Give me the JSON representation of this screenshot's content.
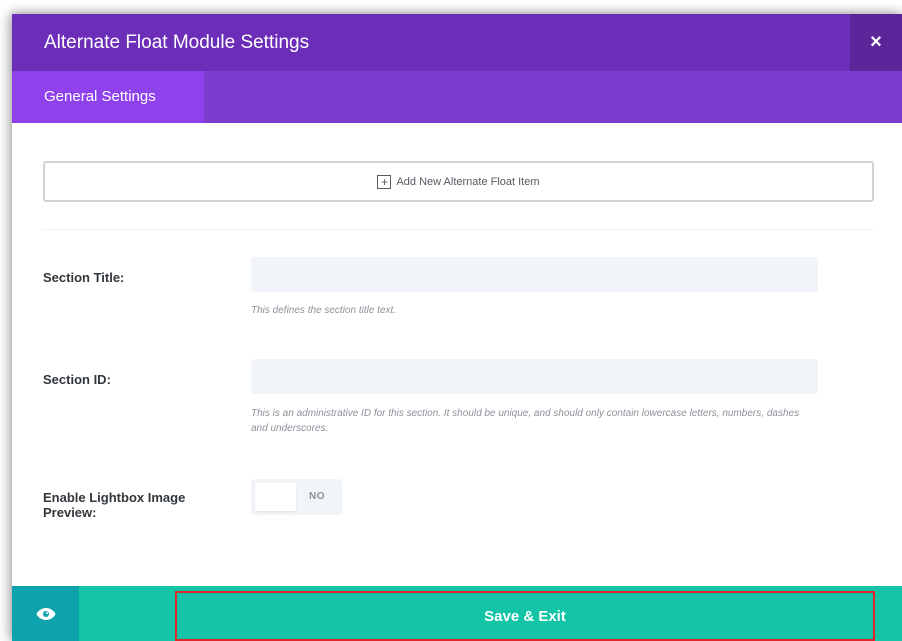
{
  "modal": {
    "title": "Alternate Float Module Settings",
    "close_label": "×"
  },
  "tabs": [
    {
      "label": "General Settings",
      "active": true
    }
  ],
  "add_item": {
    "label": "Add New Alternate Float Item"
  },
  "fields": {
    "section_title": {
      "label": "Section Title:",
      "value": "",
      "description": "This defines the section title text."
    },
    "section_id": {
      "label": "Section ID:",
      "value": "",
      "description": "This is an administrative ID for this section. It should be unique, and should only contain lowercase letters, numbers, dashes and underscores."
    },
    "lightbox": {
      "label_line1": "Enable Lightbox Image",
      "label_line2": "Preview:",
      "value": "NO"
    }
  },
  "footer": {
    "preview_icon": "eye-icon",
    "save_label": "Save & Exit"
  },
  "colors": {
    "header": "#6c2eb9",
    "tabbar": "#7e3bd0",
    "active_tab": "#8f42ec",
    "footer": "#13c5a6",
    "preview_button": "#0ea2ad",
    "highlight_border": "#e0262b"
  }
}
